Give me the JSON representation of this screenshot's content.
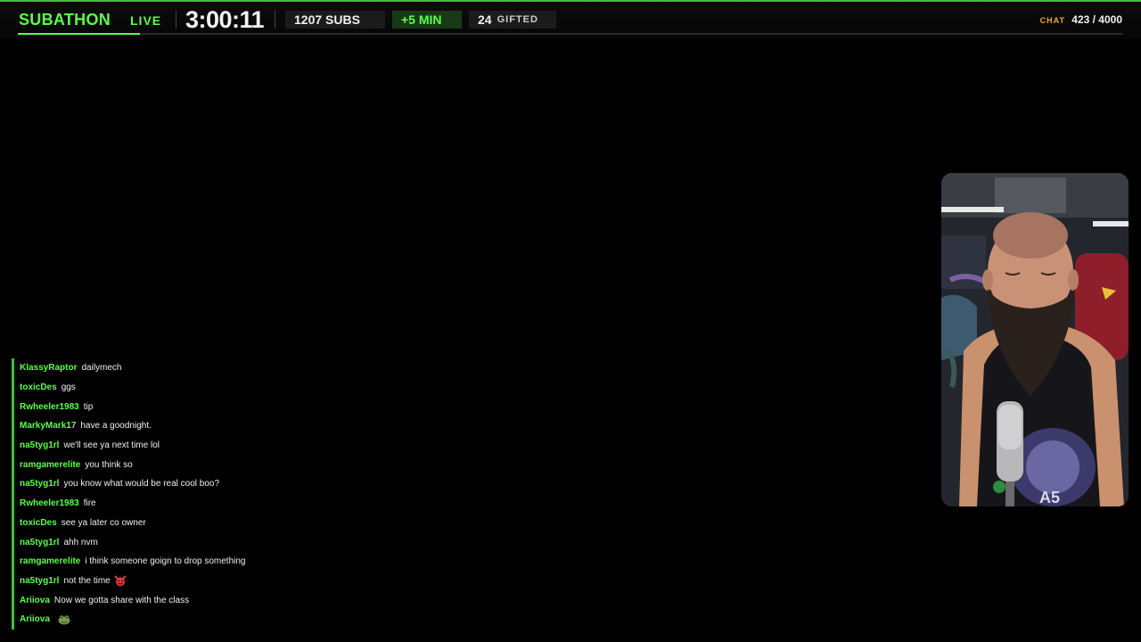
{
  "header": {
    "brand": "SUBATHON",
    "live": "LIVE",
    "timer": "3:00:11",
    "subs": "1207 SUBS",
    "bonus": "+5 MIN",
    "gifted_count": "24",
    "gifted_label": "GIFTED",
    "chat_label": "CHAT",
    "chat_count": "423 / 4000",
    "accent_color": "#5dff4a"
  },
  "chat": {
    "messages": [
      {
        "user": "KlassyRaptor",
        "text": "dailymech"
      },
      {
        "user": "toxicDes",
        "text": "ggs"
      },
      {
        "user": "Rwheeler1983",
        "text": "tip"
      },
      {
        "user": "MarkyMark17",
        "text": "have a goodnight."
      },
      {
        "user": "na5tyg1rl",
        "text": "we'll see ya next time lol"
      },
      {
        "user": "ramgamerelite",
        "text": "you think so"
      },
      {
        "user": "na5tyg1rl",
        "text": "you know what would be real cool boo?"
      },
      {
        "user": "Rwheeler1983",
        "text": "fire"
      },
      {
        "user": "toxicDes",
        "text": "see ya later co owner"
      },
      {
        "user": "na5tyg1rl",
        "text": "ahh nvm"
      },
      {
        "user": "ramgamerelite",
        "text": "i think someone goign to drop something"
      },
      {
        "user": "na5tyg1rl",
        "text": "not the time",
        "emote": "devil-emote"
      },
      {
        "user": "Ariiova",
        "text": "Now we gotta share with the class"
      },
      {
        "user": "Ariiova",
        "text": "",
        "emote": "frog-emote"
      }
    ]
  },
  "webcam": {
    "icon": "streamer-webcam"
  }
}
